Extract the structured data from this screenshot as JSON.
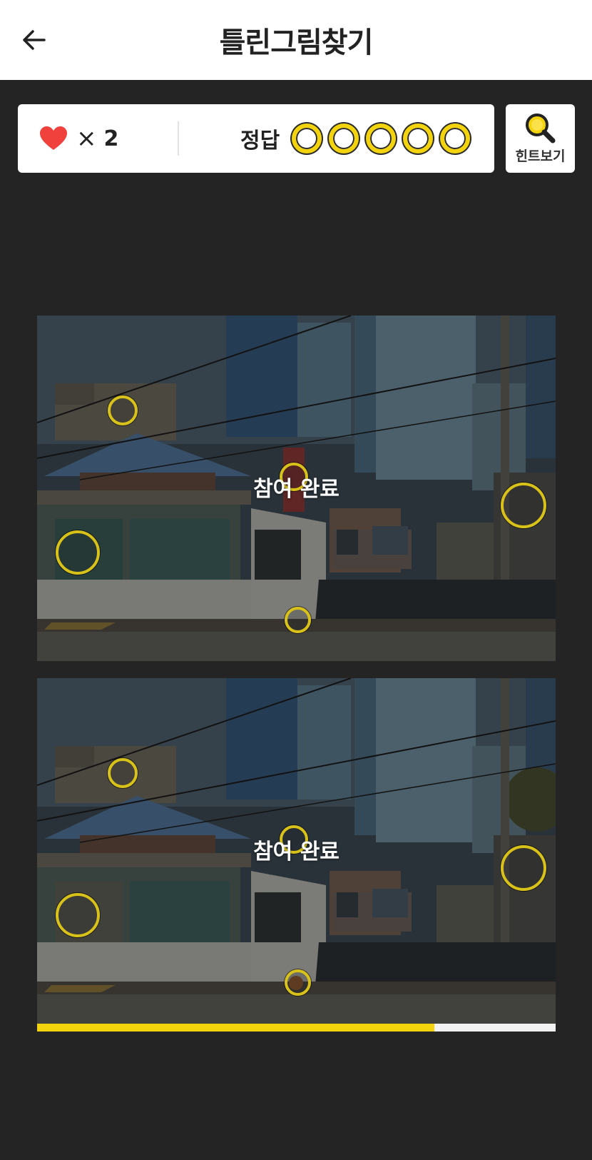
{
  "header": {
    "title": "틀린그림찾기",
    "back_icon": "arrow-left-icon"
  },
  "status": {
    "lives_icon": "heart-icon",
    "lives_multiplier": "×",
    "lives_count": "2",
    "answer_label": "정답",
    "answer_slots_total": 5,
    "answer_slots_found": 0
  },
  "hint": {
    "icon": "magnifier-icon",
    "label": "힌트보기"
  },
  "game": {
    "top_overlay": "참여 완료",
    "bottom_overlay": "참여 완료",
    "differences_marked": 5
  },
  "progress": {
    "remaining_fraction": 0.766
  },
  "colors": {
    "accent": "#f2d30e",
    "background": "#242424",
    "heart": "#f0413c"
  }
}
